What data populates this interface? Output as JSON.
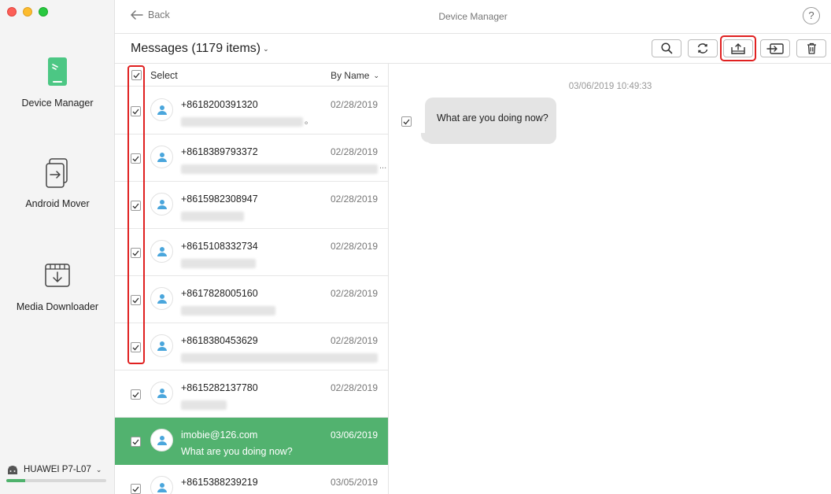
{
  "window": {
    "title": "Device Manager",
    "back_label": "Back",
    "help_label": "?"
  },
  "sidebar": {
    "items": [
      {
        "label": "Device Manager",
        "icon": "phone-icon"
      },
      {
        "label": "Android Mover",
        "icon": "transfer-icon"
      },
      {
        "label": "Media Downloader",
        "icon": "download-icon"
      }
    ],
    "device": {
      "name": "HUAWEI P7-L07",
      "storage_used_fraction": 0.19
    }
  },
  "toolbar": {
    "title": "Messages (1179 items)",
    "buttons": [
      "search-icon",
      "refresh-icon",
      "export-to-computer-icon",
      "import-to-device-icon",
      "trash-icon"
    ]
  },
  "list": {
    "select_label": "Select",
    "sort_label": "By Name",
    "rows": [
      {
        "contact": "+8618200391320",
        "date": "02/28/2019",
        "preview": "",
        "trailing": "。",
        "checked": true,
        "selected": false
      },
      {
        "contact": "+8618389793372",
        "date": "02/28/2019",
        "preview": "",
        "trailing": "...",
        "checked": true,
        "selected": false
      },
      {
        "contact": "+8615982308947",
        "date": "02/28/2019",
        "preview": "",
        "trailing": "",
        "checked": true,
        "selected": false
      },
      {
        "contact": "+8615108332734",
        "date": "02/28/2019",
        "preview": "",
        "trailing": "",
        "checked": true,
        "selected": false
      },
      {
        "contact": "+8617828005160",
        "date": "02/28/2019",
        "preview": "",
        "trailing": "",
        "checked": true,
        "selected": false
      },
      {
        "contact": "+8618380453629",
        "date": "02/28/2019",
        "preview": "",
        "trailing": "",
        "checked": true,
        "selected": false
      },
      {
        "contact": "+8615282137780",
        "date": "02/28/2019",
        "preview": "",
        "trailing": "",
        "checked": true,
        "selected": false
      },
      {
        "contact": "imobie@126.com",
        "date": "03/06/2019",
        "preview": "What are you doing now?",
        "trailing": "",
        "checked": true,
        "selected": true
      },
      {
        "contact": "+8615388239219",
        "date": "03/05/2019",
        "preview": "",
        "trailing": "",
        "checked": true,
        "selected": false
      }
    ]
  },
  "conversation": {
    "timestamp": "03/06/2019 10:49:33",
    "messages": [
      {
        "text": "What are you doing now?",
        "checked": true
      }
    ]
  },
  "colors": {
    "accent_green": "#52b26f",
    "highlight_red": "#e02020"
  }
}
